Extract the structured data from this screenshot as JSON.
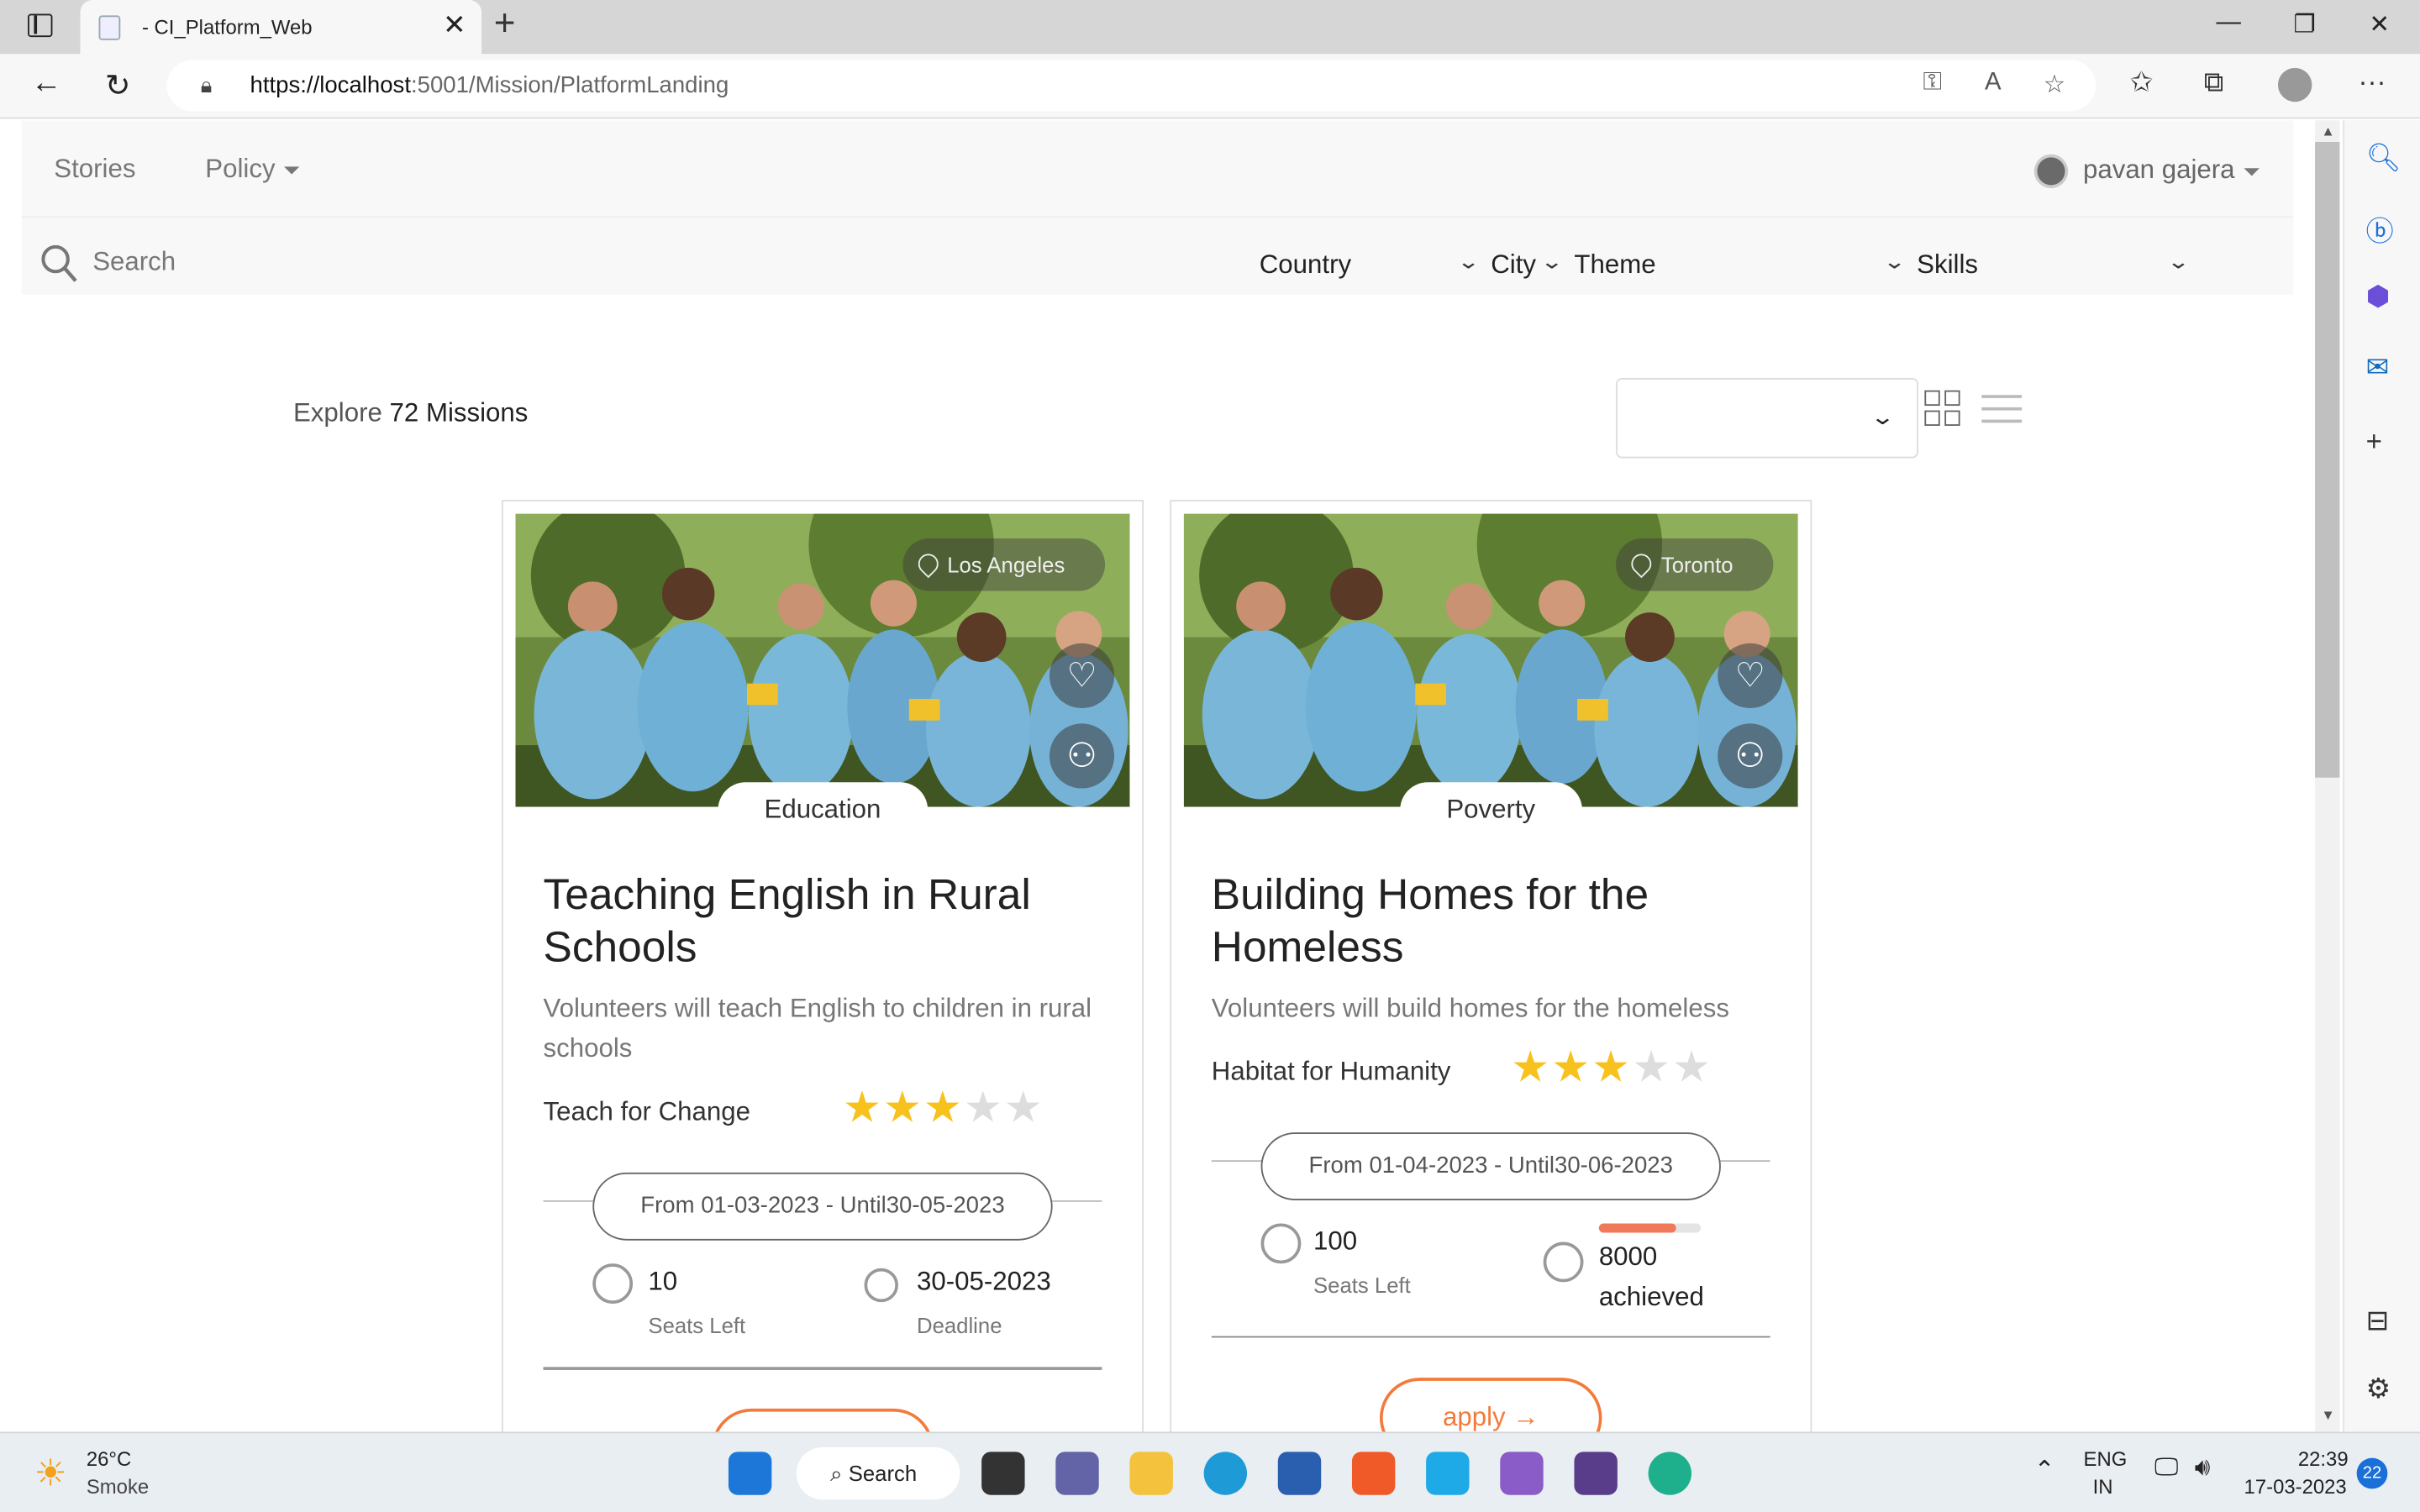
{
  "browser": {
    "tab_title": "- CI_Platform_Web",
    "url_host": "https://localhost",
    "url_path": ":5001/Mission/PlatformLanding"
  },
  "header": {
    "nav": [
      "Stories",
      "Policy"
    ],
    "user_name": "pavan gajera",
    "search_placeholder": "Search",
    "filters": [
      "Country",
      "City",
      "Theme",
      "Skills"
    ]
  },
  "listing": {
    "explore_prefix": "Explore",
    "explore_count": "72 Missions",
    "sort_value": ""
  },
  "cards": [
    {
      "location": "Los Angeles",
      "theme": "Education",
      "title": "Teaching English in Rural Schools",
      "description": "Volunteers will teach English to children in rural schools",
      "organization": "Teach for Change",
      "rating": 3,
      "date_range": "From 01-03-2023 - Until30-05-2023",
      "seats_value": "10",
      "seats_label": "Seats Left",
      "deadline_value": "30-05-2023",
      "deadline_label": "Deadline",
      "apply_label": ""
    },
    {
      "location": "Toronto",
      "theme": "Poverty",
      "title": "Building Homes for the Homeless",
      "description": "Volunteers will build homes for the homeless",
      "organization": "Habitat for Humanity",
      "rating": 3,
      "date_range": "From 01-04-2023 - Until30-06-2023",
      "seats_value": "100",
      "seats_label": "Seats Left",
      "goal_value": "8000",
      "goal_label": "achieved",
      "goal_progress": 0.75,
      "apply_label": "apply"
    }
  ],
  "taskbar": {
    "weather_temp": "26°C",
    "weather_desc": "Smoke",
    "search_label": "Search",
    "lang_1": "ENG",
    "lang_2": "IN",
    "time": "22:39",
    "date": "17-03-2023",
    "notifications": "22"
  },
  "colors": {
    "accent": "#f27b3b",
    "star": "#f7c21e",
    "progress": "#f0795a"
  }
}
